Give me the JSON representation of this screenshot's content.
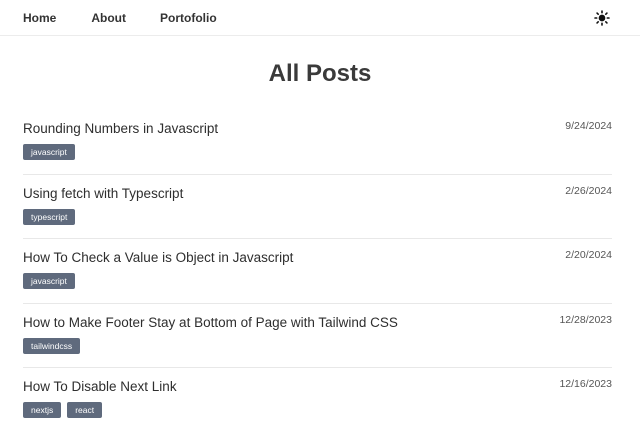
{
  "nav": {
    "links": [
      "Home",
      "About",
      "Portofolio"
    ],
    "theme_icon": "sun-icon"
  },
  "page": {
    "title": "All Posts"
  },
  "posts": [
    {
      "title": "Rounding Numbers in Javascript",
      "date": "9/24/2024",
      "tags": [
        "javascript"
      ]
    },
    {
      "title": "Using fetch with Typescript",
      "date": "2/26/2024",
      "tags": [
        "typescript"
      ]
    },
    {
      "title": "How To Check a Value is Object in Javascript",
      "date": "2/20/2024",
      "tags": [
        "javascript"
      ]
    },
    {
      "title": "How to Make Footer Stay at Bottom of Page with Tailwind CSS",
      "date": "12/28/2023",
      "tags": [
        "tailwindcss"
      ]
    },
    {
      "title": "How To Disable Next Link",
      "date": "12/16/2023",
      "tags": [
        "nextjs",
        "react"
      ]
    }
  ],
  "colors": {
    "tag_bg": "#5f6a7d",
    "text": "#333333"
  }
}
